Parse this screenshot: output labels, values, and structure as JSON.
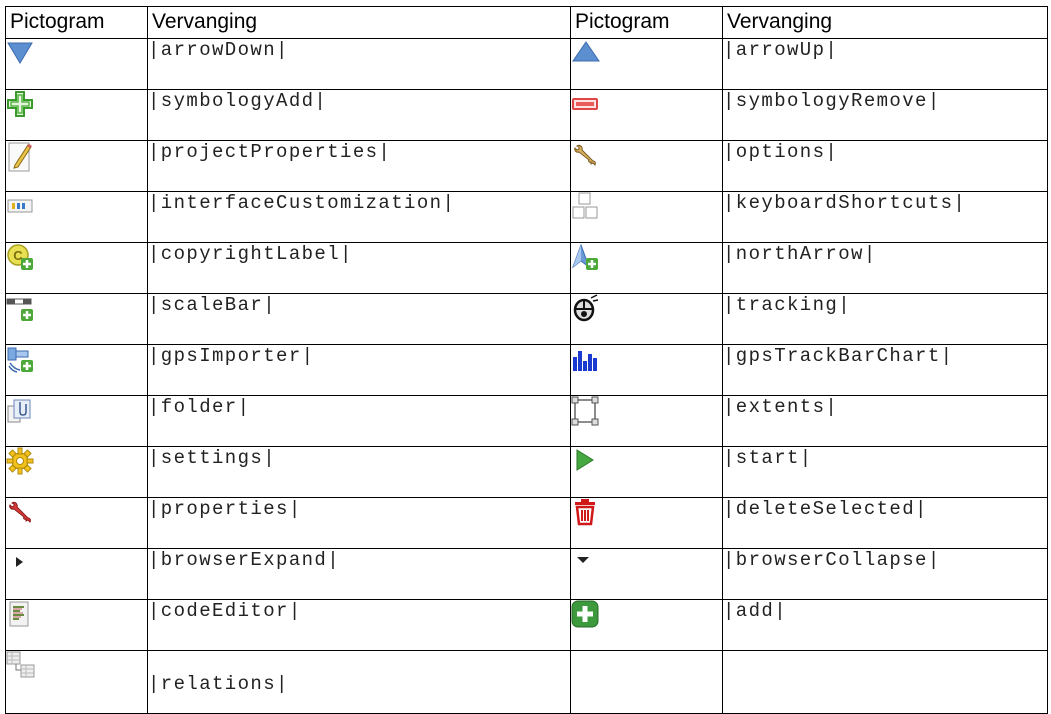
{
  "table": {
    "headers": [
      "Pictogram",
      "Vervanging",
      "Pictogram",
      "Vervanging"
    ],
    "rows": [
      [
        {
          "icon": "arrow-down-icon",
          "text": "|arrowDown|"
        },
        {
          "icon": "arrow-up-icon",
          "text": "|arrowUp|"
        }
      ],
      [
        {
          "icon": "symbology-add-icon",
          "text": "|symbologyAdd|"
        },
        {
          "icon": "symbology-remove-icon",
          "text": "|symbologyRemove|"
        }
      ],
      [
        {
          "icon": "project-properties-icon",
          "text": "|projectProperties|"
        },
        {
          "icon": "options-icon",
          "text": "|options|"
        }
      ],
      [
        {
          "icon": "interface-customization-icon",
          "text": "|interfaceCustomization|"
        },
        {
          "icon": "keyboard-shortcuts-icon",
          "text": "|keyboardShortcuts|"
        }
      ],
      [
        {
          "icon": "copyright-label-icon",
          "text": "|copyrightLabel|"
        },
        {
          "icon": "north-arrow-icon",
          "text": "|northArrow|"
        }
      ],
      [
        {
          "icon": "scale-bar-icon",
          "text": "|scaleBar|"
        },
        {
          "icon": "tracking-icon",
          "text": "|tracking|"
        }
      ],
      [
        {
          "icon": "gps-importer-icon",
          "text": "|gpsImporter|"
        },
        {
          "icon": "gps-track-bar-chart-icon",
          "text": "|gpsTrackBarChart|"
        }
      ],
      [
        {
          "icon": "folder-icon",
          "text": "|folder|"
        },
        {
          "icon": "extents-icon",
          "text": "|extents|"
        }
      ],
      [
        {
          "icon": "settings-icon",
          "text": "|settings|"
        },
        {
          "icon": "start-icon",
          "text": "|start|"
        }
      ],
      [
        {
          "icon": "properties-icon",
          "text": "|properties|"
        },
        {
          "icon": "delete-selected-icon",
          "text": "|deleteSelected|"
        }
      ],
      [
        {
          "icon": "browser-expand-icon",
          "text": "|browserExpand|"
        },
        {
          "icon": "browser-collapse-icon",
          "text": "|browserCollapse|"
        }
      ],
      [
        {
          "icon": "code-editor-icon",
          "text": "|codeEditor|"
        },
        {
          "icon": "add-icon",
          "text": "|add|"
        }
      ],
      [
        {
          "icon": "relations-icon",
          "text": "|relations|"
        },
        {
          "icon": "",
          "text": ""
        }
      ]
    ]
  }
}
